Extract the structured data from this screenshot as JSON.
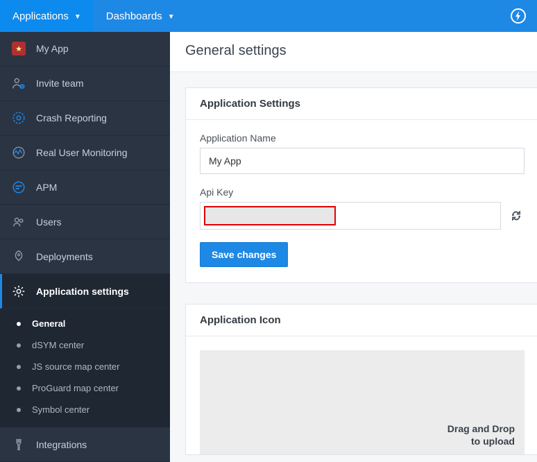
{
  "topbar": {
    "applications_label": "Applications",
    "dashboards_label": "Dashboards"
  },
  "sidebar": {
    "app_name": "My App",
    "invite_team": "Invite team",
    "crash_reporting": "Crash Reporting",
    "rum": "Real User Monitoring",
    "apm": "APM",
    "users": "Users",
    "deployments": "Deployments",
    "app_settings": "Application settings",
    "subs": {
      "general": "General",
      "dsym": "dSYM center",
      "jsmap": "JS source map center",
      "proguard": "ProGuard map center",
      "symbol": "Symbol center"
    },
    "integrations": "Integrations"
  },
  "page": {
    "title": "General settings",
    "panel1_title": "Application Settings",
    "appname_label": "Application Name",
    "appname_value": "My App",
    "apikey_label": "Api Key",
    "save_button": "Save changes",
    "panel2_title": "Application Icon",
    "drop_line1": "Drag and Drop",
    "drop_line2": "to upload"
  }
}
